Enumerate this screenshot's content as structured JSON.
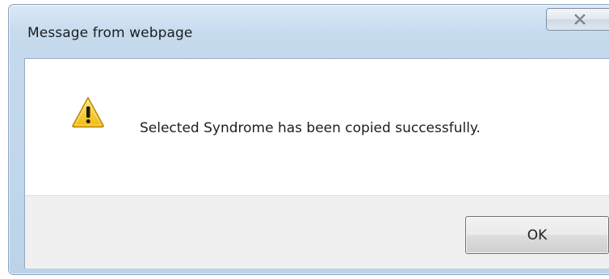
{
  "window": {
    "title": "Message from webpage"
  },
  "titlebar": {
    "close_icon": "close-x-icon"
  },
  "dialog": {
    "icon": "warning-icon",
    "message": "Selected Syndrome has been copied successfully.",
    "ok_label": "OK"
  },
  "colors": {
    "frame": "#c6daee",
    "button_area": "#f0f0f0",
    "warning_fill": "#f7c722"
  }
}
